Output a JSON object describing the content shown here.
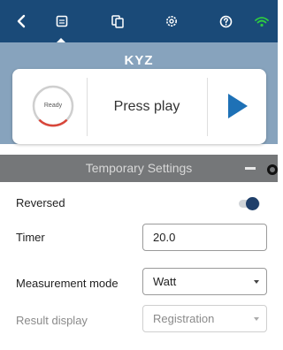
{
  "nav": {
    "icons": [
      "back-chevron-icon",
      "device-panel-icon",
      "copy-pages-icon",
      "settings-cog-icon",
      "help-icon",
      "wifi-icon"
    ],
    "colors": {
      "background": "#1a4a78",
      "icon": "#ffffff",
      "wifi": "#2ecc40"
    }
  },
  "device": {
    "name": "KYZ",
    "status_label": "Ready",
    "prompt": "Press play",
    "colors": {
      "header": "#87a3bd",
      "ring": "#d9463a",
      "play": "#1e71b6"
    }
  },
  "settings": {
    "section_title": "Temporary Settings",
    "reversed_label": "Reversed",
    "reversed_on": true,
    "timer_label": "Timer",
    "timer_value": "20.0",
    "mode_label": "Measurement mode",
    "mode_value": "Watt",
    "result_label": "Result display",
    "result_value": "Registration",
    "colors": {
      "section": "#757779"
    }
  }
}
